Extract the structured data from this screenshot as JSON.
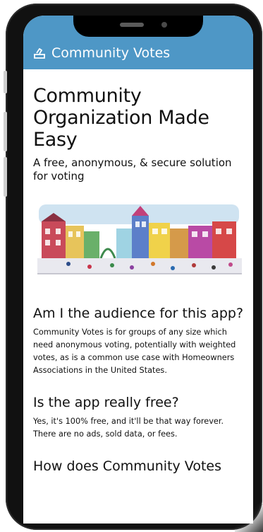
{
  "app": {
    "title": "Community Votes",
    "brand_color": "#4e97c6"
  },
  "hero": {
    "heading": "Community Organization Made Easy",
    "subheading": "A free, anonymous, & secure solution for voting",
    "illustration_icon": "town-street-illustration"
  },
  "sections": [
    {
      "heading": "Am I the audience for this app?",
      "body": "Community Votes is for groups of any size which need anonymous voting, potentially with weighted votes, as is a common use case with Homeowners Associations in the United States."
    },
    {
      "heading": "Is the app really free?",
      "body": "Yes, it's 100% free, and it'll be that way forever. There are no ads, sold data, or fees."
    },
    {
      "heading": "How does Community Votes"
    }
  ]
}
